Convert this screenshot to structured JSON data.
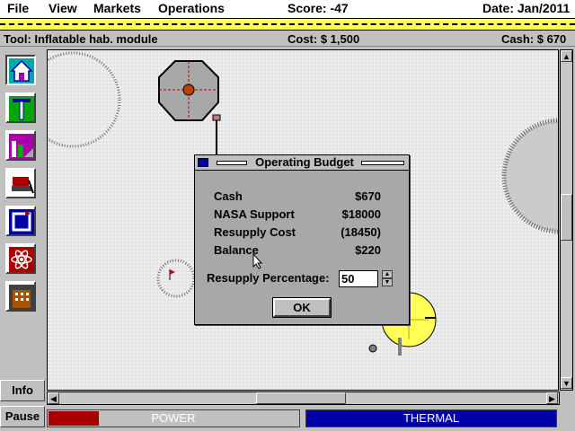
{
  "menu": {
    "file": "File",
    "view": "View",
    "markets": "Markets",
    "operations": "Operations",
    "score": "Score: -47",
    "date": "Date: Jan/2011"
  },
  "toolline": {
    "tool": "Tool: Inflatable hab. module",
    "cost": "Cost: $ 1,500",
    "cash": "Cash: $ 670"
  },
  "palette": {
    "tools": [
      "habitat-tool-icon",
      "pylon-tool-icon",
      "factory-tool-icon",
      "rover-tool-icon",
      "recycle-tool-icon",
      "atom-tool-icon",
      "building-tool-icon"
    ],
    "info": "Info",
    "pause": "Pause"
  },
  "status": {
    "power_label": "POWER",
    "power_level": 0.2,
    "thermal_label": "THERMAL",
    "power_color": "#a80000",
    "thermal_color": "#0000a8"
  },
  "dialog": {
    "title": "Operating Budget",
    "rows": [
      {
        "label": "Cash",
        "value": "$670"
      },
      {
        "label": "NASA Support",
        "value": "$18000"
      },
      {
        "label": "Resupply Cost",
        "value": "(18450)"
      },
      {
        "label": "Balance",
        "value": "$220"
      }
    ],
    "resupply_label": "Resupply Percentage:",
    "resupply_value": "50",
    "ok_label": "OK"
  }
}
